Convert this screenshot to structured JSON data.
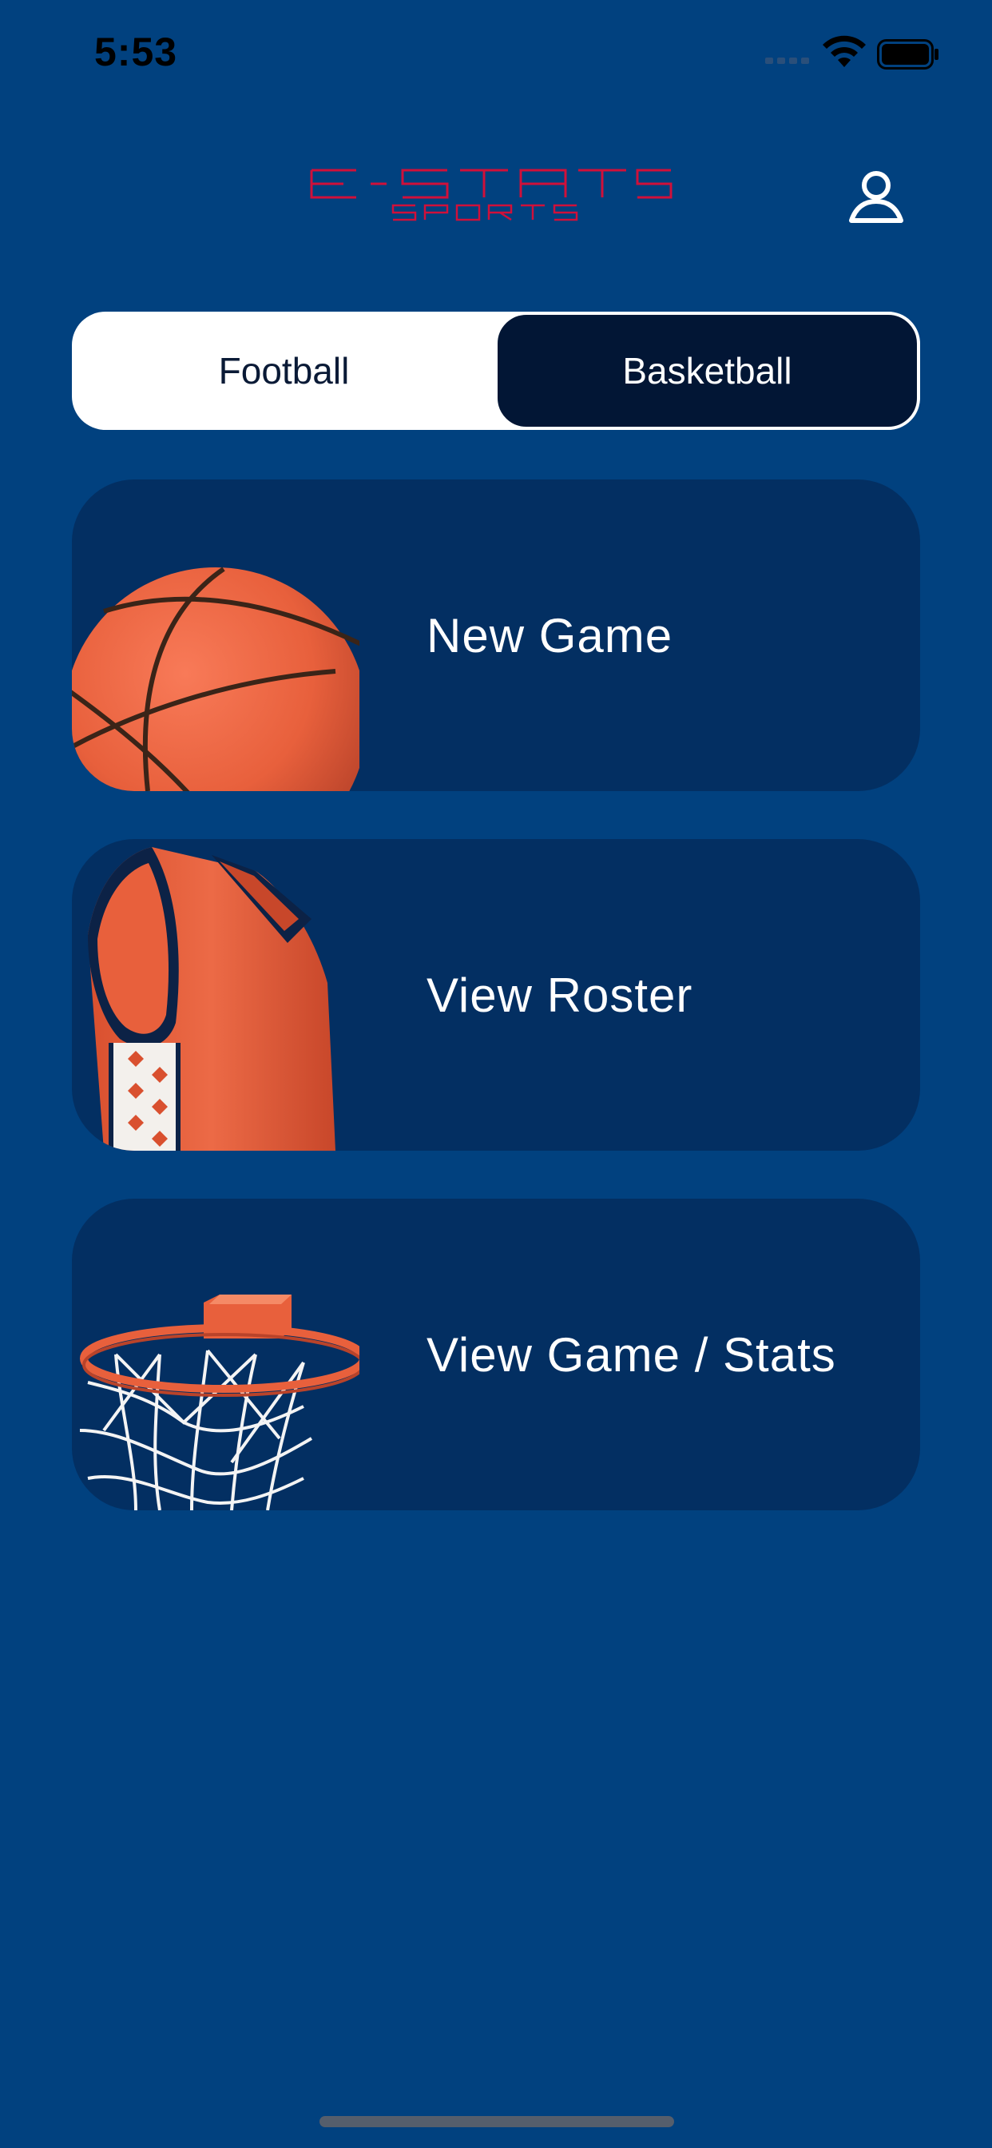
{
  "status_bar": {
    "time": "5:53"
  },
  "header": {
    "logo_text": "E-STATS",
    "logo_subtext": "SPORTS",
    "profile_icon": "person-icon"
  },
  "segment": {
    "options": [
      "Football",
      "Basketball"
    ],
    "selected": "Basketball"
  },
  "menu": {
    "items": [
      {
        "label": "New Game",
        "image": "basketball-ball"
      },
      {
        "label": "View Roster",
        "image": "basketball-jersey"
      },
      {
        "label": "View Game / Stats",
        "image": "basketball-hoop"
      }
    ]
  },
  "colors": {
    "background": "#01417f",
    "card": "#032f62",
    "selected_segment": "#021635",
    "logo": "#d0103a",
    "accent_orange": "#e8603c"
  }
}
